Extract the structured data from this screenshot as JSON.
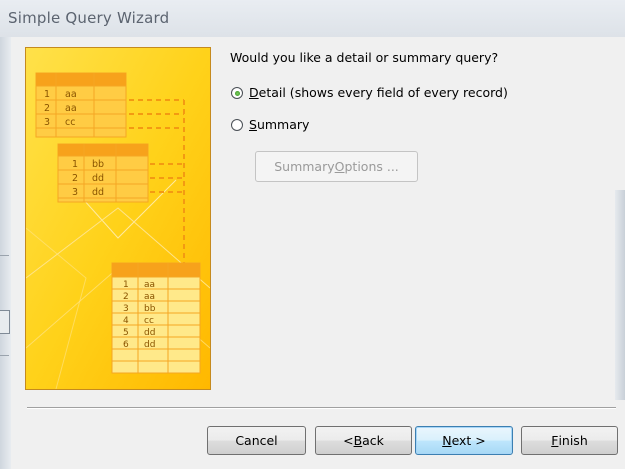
{
  "window": {
    "title": "Simple Query Wizard"
  },
  "question": "Would you like a detail or summary query?",
  "options": {
    "detail": {
      "accel": "D",
      "rest": "etail (shows every field of every record)",
      "selected": true
    },
    "summary": {
      "accel": "S",
      "rest": "ummary",
      "selected": false
    }
  },
  "summary_options_button": {
    "pre": "Summary ",
    "accel": "O",
    "post": "ptions ..."
  },
  "buttons": {
    "cancel": {
      "label": "Cancel"
    },
    "back": {
      "pre": "< ",
      "accel": "B",
      "post": "ack"
    },
    "next": {
      "accel": "N",
      "post": "ext >"
    },
    "finish": {
      "accel": "F",
      "post": "inish"
    }
  },
  "illustration": {
    "table1": [
      [
        "1",
        "aa"
      ],
      [
        "2",
        "aa"
      ],
      [
        "3",
        "cc"
      ]
    ],
    "table2": [
      [
        "1",
        "bb"
      ],
      [
        "2",
        "dd"
      ],
      [
        "3",
        "dd"
      ]
    ],
    "table3": [
      [
        "1",
        "aa"
      ],
      [
        "2",
        "aa"
      ],
      [
        "3",
        "bb"
      ],
      [
        "4",
        "cc"
      ],
      [
        "5",
        "dd"
      ],
      [
        "6",
        "dd"
      ]
    ]
  },
  "colors": {
    "accent_orange": "#f39a12",
    "illus_yellow": "#ffd21a",
    "default_button": "#3c7fb1"
  }
}
